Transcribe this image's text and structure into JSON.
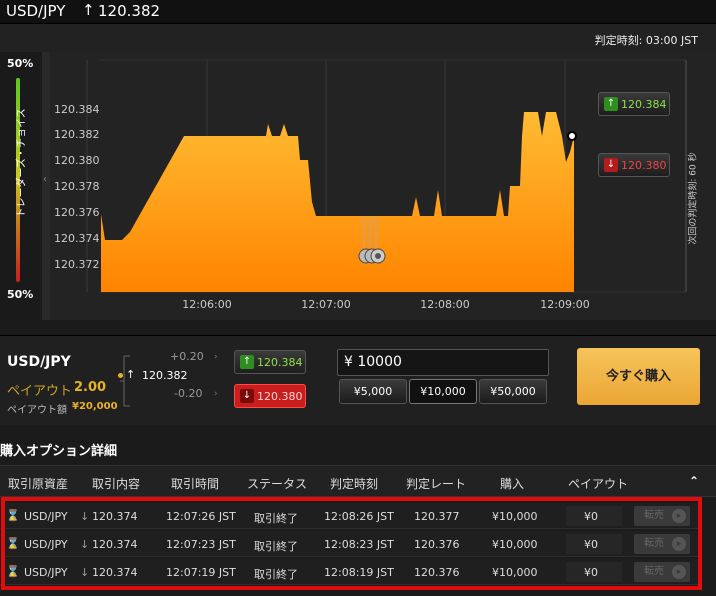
{
  "header": {
    "pair": "USD/JPY",
    "arrow": "↑",
    "rate": "120.382"
  },
  "judge": {
    "label": "判定時刻:",
    "time": "03:00 JST"
  },
  "sentiment": {
    "top": "50%",
    "bottom": "50%",
    "label": "トレーダーズ・チョイス",
    "up_color": "#5cc81e",
    "down_color": "#c81e1e"
  },
  "chart": {
    "y_ticks": [
      "120.384",
      "120.382",
      "120.380",
      "120.378",
      "120.376",
      "120.374",
      "120.372"
    ],
    "x_ticks": [
      "12:06:00",
      "12:07:00",
      "12:08:00",
      "12:09:00"
    ],
    "high": "120.384",
    "low": "120.380",
    "next_label": "次回の判定時刻: 60 秒",
    "fill_top": "#ffbb33",
    "fill_bottom": "#ff8400"
  },
  "trade": {
    "pair": "USD/JPY",
    "payout_label": "ペイアウト",
    "payout_value": "2.00",
    "payout_amount_label": "ペイアウト額",
    "payout_amount": "¥20,000",
    "offset_up": "+0.20",
    "offset_down": "-0.20",
    "current_arrow": "↑",
    "current_rate": "120.382",
    "high_rate": "120.384",
    "low_rate": "120.380",
    "amount": "¥ 10000",
    "amount_buttons": [
      "¥5,000",
      "¥10,000",
      "¥50,000"
    ],
    "buy_label": "今すぐ購入"
  },
  "details": {
    "title": "購入オプション詳細",
    "columns": [
      "取引原資産",
      "取引内容",
      "取引時間",
      "ステータス",
      "判定時刻",
      "判定レート",
      "購入",
      "ペイアウト"
    ],
    "rows": [
      {
        "asset": "USD/JPY",
        "direction": "↓",
        "rate": "120.374",
        "time": "12:07:26 JST",
        "status": "取引終了",
        "judge": "12:08:26 JST",
        "judge_rate": "120.377",
        "purchase": "¥10,000",
        "payout": "¥0",
        "resale": "転売"
      },
      {
        "asset": "USD/JPY",
        "direction": "↓",
        "rate": "120.374",
        "time": "12:07:23 JST",
        "status": "取引終了",
        "judge": "12:08:23 JST",
        "judge_rate": "120.376",
        "purchase": "¥10,000",
        "payout": "¥0",
        "resale": "転売"
      },
      {
        "asset": "USD/JPY",
        "direction": "↓",
        "rate": "120.374",
        "time": "12:07:19 JST",
        "status": "取引終了",
        "judge": "12:08:19 JST",
        "judge_rate": "120.376",
        "purchase": "¥10,000",
        "payout": "¥0",
        "resale": "転売"
      }
    ]
  }
}
